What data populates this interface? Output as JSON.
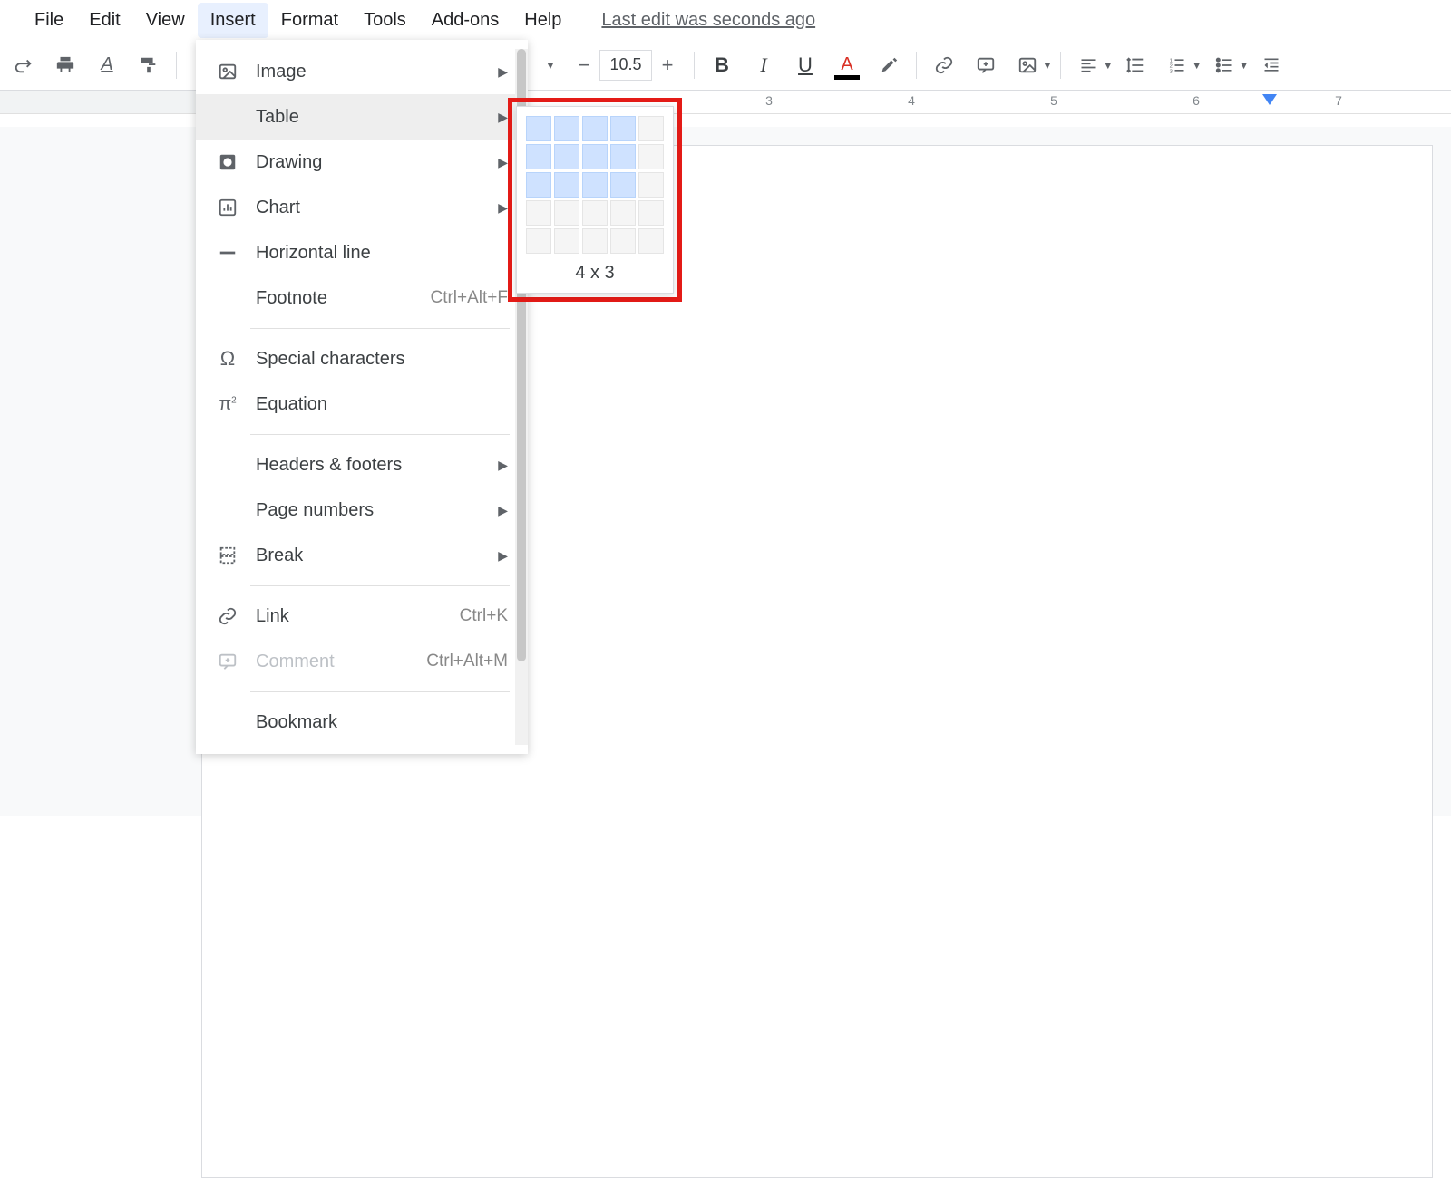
{
  "menubar": {
    "items": [
      "File",
      "Edit",
      "View",
      "Insert",
      "Format",
      "Tools",
      "Add-ons",
      "Help"
    ],
    "active_index": 3,
    "last_edit": "Last edit was seconds ago"
  },
  "toolbar": {
    "font_size": "10.5"
  },
  "ruler": {
    "numbers": [
      3,
      4,
      5,
      6,
      7
    ],
    "marker_at": 6.2
  },
  "insert_menu": {
    "items": [
      {
        "label": "Image",
        "icon": "image",
        "submenu": true
      },
      {
        "label": "Table",
        "icon": "table",
        "submenu": true,
        "active": true
      },
      {
        "label": "Drawing",
        "icon": "drawing",
        "submenu": true
      },
      {
        "label": "Chart",
        "icon": "chart",
        "submenu": true
      },
      {
        "label": "Horizontal line",
        "icon": "hline"
      },
      {
        "label": "Footnote",
        "icon": "",
        "shortcut": "Ctrl+Alt+F"
      },
      {
        "sep": true
      },
      {
        "label": "Special characters",
        "icon": "omega"
      },
      {
        "label": "Equation",
        "icon": "pi"
      },
      {
        "sep": true
      },
      {
        "label": "Headers & footers",
        "icon": "",
        "submenu": true
      },
      {
        "label": "Page numbers",
        "icon": "",
        "submenu": true
      },
      {
        "label": "Break",
        "icon": "break",
        "submenu": true
      },
      {
        "sep": true
      },
      {
        "label": "Link",
        "icon": "link",
        "shortcut": "Ctrl+K"
      },
      {
        "label": "Comment",
        "icon": "comment",
        "shortcut": "Ctrl+Alt+M",
        "disabled": true
      },
      {
        "sep": true
      },
      {
        "label": "Bookmark",
        "icon": ""
      }
    ]
  },
  "table_picker": {
    "cols": 4,
    "rows": 3,
    "grid_cols": 5,
    "grid_rows": 5,
    "label": "4 x 3"
  }
}
